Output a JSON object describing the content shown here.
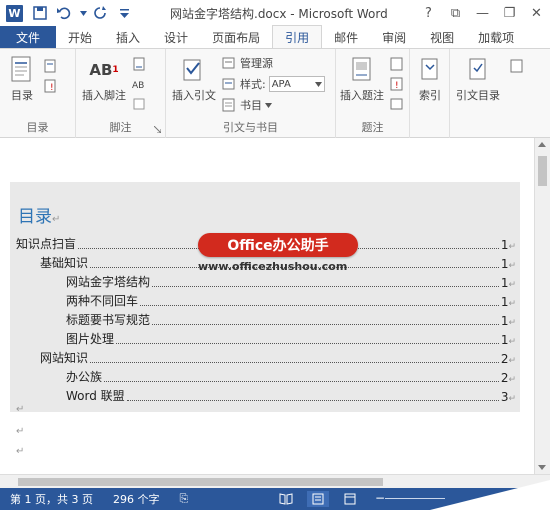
{
  "window": {
    "title": "网站金字塔结构.docx - Microsoft Word",
    "app_logo": "W",
    "help": "?",
    "ribbon_options": "⧉",
    "minimize": "—",
    "restore": "❐",
    "close": "✕"
  },
  "tabs": [
    {
      "label": "文件"
    },
    {
      "label": "开始"
    },
    {
      "label": "插入"
    },
    {
      "label": "设计"
    },
    {
      "label": "页面布局"
    },
    {
      "label": "引用"
    },
    {
      "label": "邮件"
    },
    {
      "label": "审阅"
    },
    {
      "label": "视图"
    },
    {
      "label": "加载项"
    }
  ],
  "ribbon": {
    "toc_group": {
      "label": "目录",
      "toc_button": "目录"
    },
    "footnote_group": {
      "label": "脚注",
      "insert_footnote": "插入脚注",
      "ab_icon": "AB"
    },
    "citation_group": {
      "label": "引文与书目",
      "insert_citation": "插入引文",
      "manage_sources": "管理源",
      "style_label": "样式:",
      "style_value": "APA",
      "bibliography": "书目"
    },
    "caption_group": {
      "label": "题注",
      "insert_caption": "插入题注"
    },
    "index_group": {
      "label": "索引",
      "index_button": "索引"
    },
    "toa_group": {
      "label": "引文目录",
      "toa_button": "引文目录"
    }
  },
  "document": {
    "toc_title": "目录",
    "para_mark": "↵",
    "entries": [
      {
        "text": "知识点扫盲",
        "page": "1"
      },
      {
        "text": "基础知识",
        "page": "1"
      },
      {
        "text": "网站金字塔结构",
        "page": "1"
      },
      {
        "text": "两种不同回车",
        "page": "1"
      },
      {
        "text": "标题要书写规范",
        "page": "1"
      },
      {
        "text": "图片处理",
        "page": "1"
      },
      {
        "text": "网站知识",
        "page": "2"
      },
      {
        "text": "办公族",
        "page": "2"
      },
      {
        "text": "Word 联盟",
        "page": "3"
      }
    ]
  },
  "watermark": {
    "badge": "Office办公助手",
    "url": "www.officezhushou.com"
  },
  "status": {
    "page_info": "第 1 页，共 3 页",
    "word_count": "296 个字",
    "proofing_icon": "⎘"
  }
}
